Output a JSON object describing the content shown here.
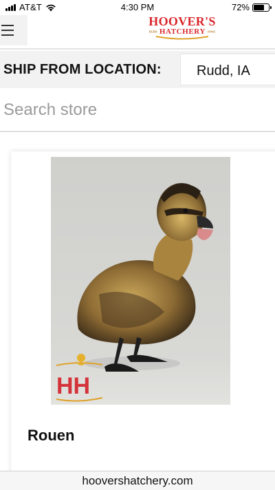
{
  "status_bar": {
    "carrier": "AT&T",
    "time": "4:30 PM",
    "battery_percent": "72%",
    "battery_level": 0.72
  },
  "header": {
    "logo_main": "HOOVER'S",
    "logo_sub": "HATCHERY",
    "logo_small_left": "RUDD",
    "logo_small_right": "IOWA",
    "brand_color": "#d9262b"
  },
  "ship_from": {
    "label": "SHIP FROM LOCATION:",
    "selected_location": "Rudd, IA"
  },
  "search": {
    "placeholder": "Search store"
  },
  "product": {
    "name": "Rouen",
    "watermark": "HH"
  },
  "browser": {
    "url": "hoovershatchery.com"
  }
}
